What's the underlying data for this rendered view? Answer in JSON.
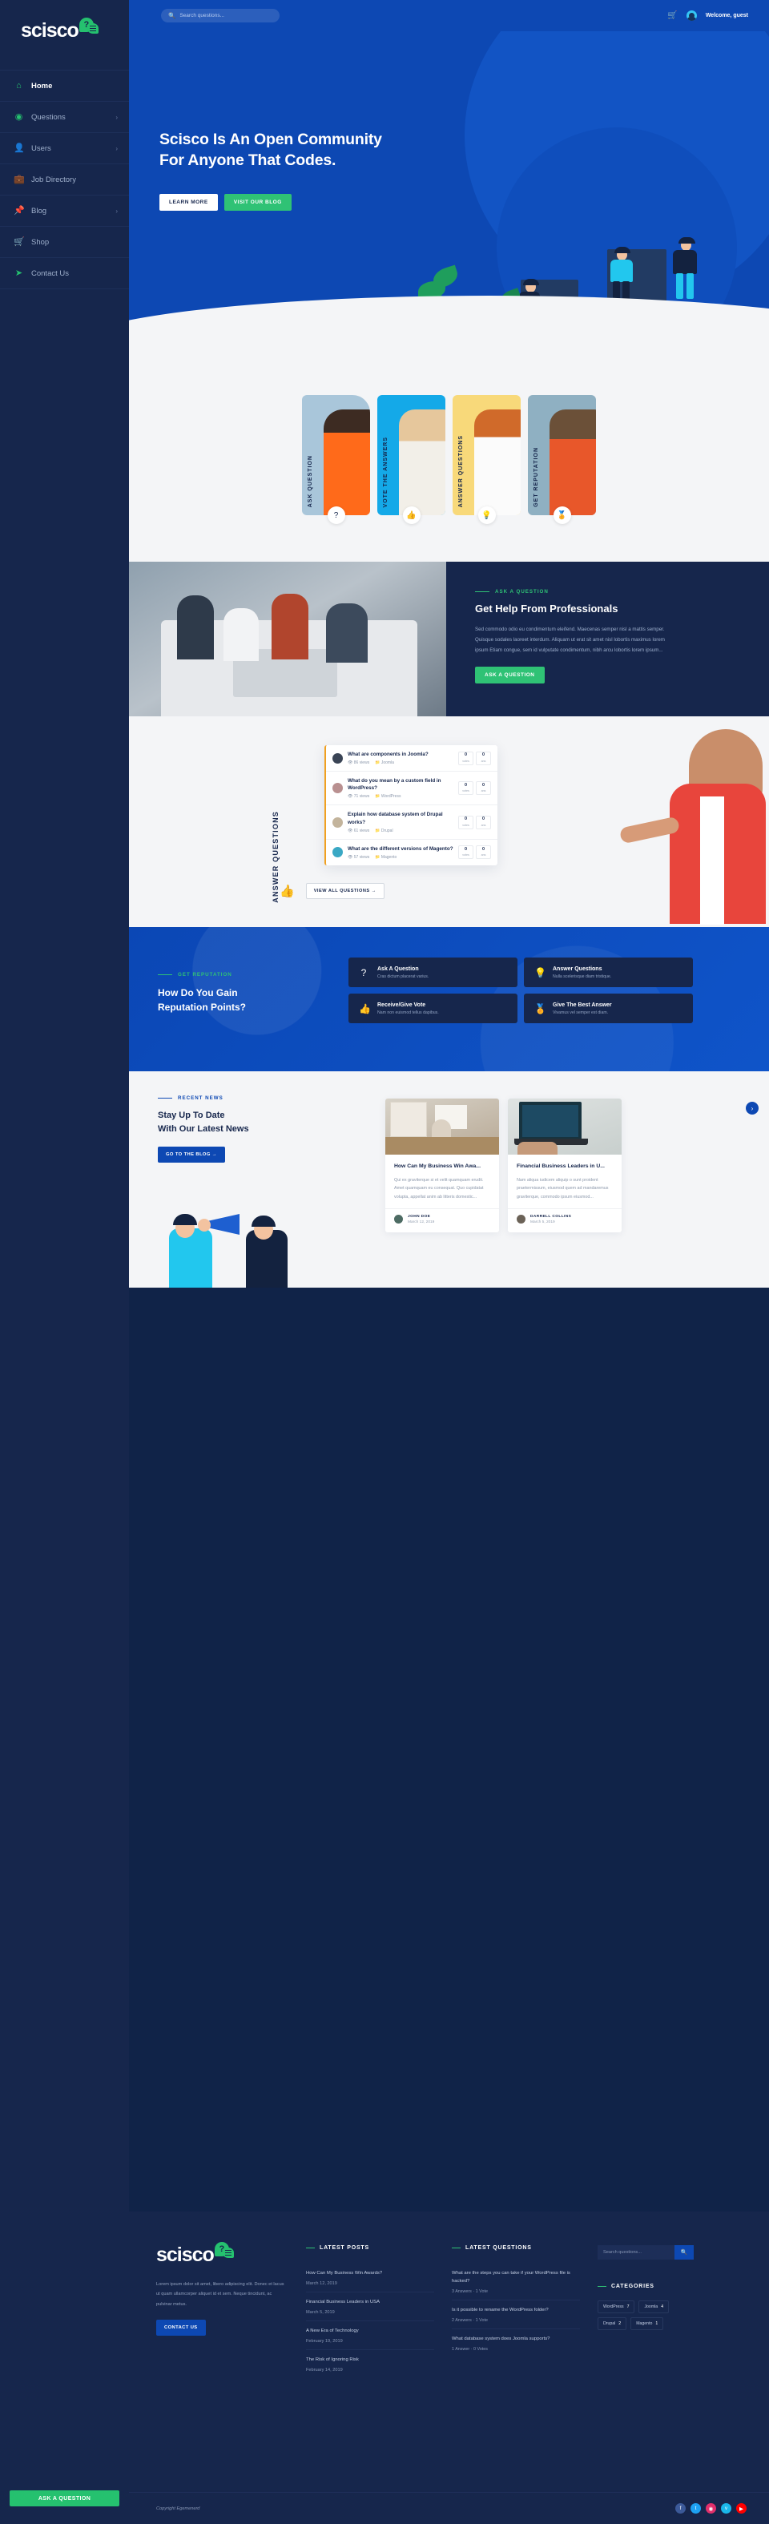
{
  "brand": {
    "name": "scisco",
    "badge_icon": "question-bubble"
  },
  "sidebar": {
    "items": [
      {
        "label": "Home",
        "icon": "home-icon",
        "has_caret": false,
        "active": true
      },
      {
        "label": "Questions",
        "icon": "question-icon",
        "has_caret": true,
        "active": false
      },
      {
        "label": "Users",
        "icon": "user-icon",
        "has_caret": true,
        "active": false
      },
      {
        "label": "Job Directory",
        "icon": "briefcase-icon",
        "has_caret": false,
        "active": false
      },
      {
        "label": "Blog",
        "icon": "pin-icon",
        "has_caret": true,
        "active": false
      },
      {
        "label": "Shop",
        "icon": "cart-icon",
        "has_caret": false,
        "active": false
      },
      {
        "label": "Contact Us",
        "icon": "paper-plane-icon",
        "has_caret": false,
        "active": false
      }
    ],
    "ask_button": "ASK A QUESTION"
  },
  "topbar": {
    "search_placeholder": "Search questions...",
    "cart_icon": "cart-icon",
    "welcome": "Welcome, guest"
  },
  "hero": {
    "title_line1": "Scisco Is An Open Community",
    "title_line2": "For Anyone That Codes.",
    "btn_primary": "LEARN MORE",
    "btn_secondary": "VISIT OUR BLOG"
  },
  "cards": [
    {
      "label": "ASK QUESTION",
      "bg": "#a9c6da",
      "badge": "?",
      "badge_icon": "question-mark-icon"
    },
    {
      "label": "VOTE THE ANSWERS",
      "bg": "#14a9e8",
      "badge": "👍",
      "badge_icon": "thumbs-up-icon"
    },
    {
      "label": "ANSWER QUESTIONS",
      "bg": "#f8d97a",
      "badge": "💡",
      "badge_icon": "lightbulb-icon"
    },
    {
      "label": "GET REPUTATION",
      "bg": "#8fb0c2",
      "badge": "🏅",
      "badge_icon": "medal-icon"
    }
  ],
  "professionals": {
    "eyebrow": "ASK A QUESTION",
    "title": "Get Help From Professionals",
    "body": "Sed commodo odio eu condimentum eleifend. Maecenas semper nisl a mattis semper. Quisque sodales laoreet interdum. Aliquam ut erat sit amet nisl lobortis maximus lorem ipsum Etiam congue, sem id vulputate condimentum, nibh arcu lobortis lorem ipsum...",
    "button": "ASK A QUESTION"
  },
  "answer_questions": {
    "vertical_label": "ANSWER QUESTIONS",
    "view_all": "VIEW ALL QUESTIONS →",
    "thumb_icon": "thumbs-up-icon",
    "stat_labels": {
      "votes": "votes",
      "ans": "ans"
    },
    "rows": [
      {
        "title": "What are components in Joomla?",
        "views": "86 views",
        "category": "Joomla",
        "votes": "0",
        "ans": "0",
        "av": "#3a4455"
      },
      {
        "title": "What do you mean by a custom field in WordPress?",
        "views": "71 views",
        "category": "WordPress",
        "votes": "0",
        "ans": "0",
        "av": "#b99090"
      },
      {
        "title": "Explain how database system of Drupal works?",
        "views": "61 views",
        "category": "Drupal",
        "votes": "0",
        "ans": "0",
        "av": "#c3b49c"
      },
      {
        "title": "What are the different versions of Magento?",
        "views": "57 views",
        "category": "Magento",
        "votes": "0",
        "ans": "0",
        "av": "#3aa8c4"
      }
    ]
  },
  "reputation": {
    "eyebrow": "GET REPUTATION",
    "title_line1": "How Do You Gain",
    "title_line2": "Reputation Points?",
    "cards": [
      {
        "icon": "question-mark-icon",
        "glyph": "?",
        "title": "Ask A Question",
        "desc": "Cras dictum placerat varius."
      },
      {
        "icon": "lightbulb-icon",
        "glyph": "💡",
        "title": "Answer Questions",
        "desc": "Nulla scelerisque diam tristique."
      },
      {
        "icon": "thumbs-up-icon",
        "glyph": "👍",
        "title": "Receive/Give Vote",
        "desc": "Nam non euismod tellus dapibus."
      },
      {
        "icon": "medal-icon",
        "glyph": "🏅",
        "title": "Give The Best Answer",
        "desc": "Vivamus vel semper est diam."
      }
    ]
  },
  "news": {
    "eyebrow": "RECENT NEWS",
    "title_line1": "Stay Up To Date",
    "title_line2": "With Our Latest News",
    "button": "GO TO THE BLOG →",
    "next_icon": "chevron-right-icon",
    "posts": [
      {
        "title": "How Can My Business Win Awa...",
        "excerpt": "Qui ex graviterque si et velit quamquam erudit. Amet quamquam eu consequat. Quo cupidatat volupta, appellat anim ab litteris domestic...",
        "author": "JOHN DOE",
        "date": "March 12, 2019"
      },
      {
        "title": "Financial Business Leaders in U...",
        "excerpt": "Nam aliqua iudicem aliquip o sunt proident praetermissum, eiusmod quem ad mandaremus graviterque, commodo ipsum eiusmod...",
        "author": "DARRELL COLLINS",
        "date": "March 5, 2019"
      }
    ]
  },
  "footer": {
    "about": "Lorem ipsum dolor sit amet, libero adipiscing elit. Donec et lacus ut quam ullamcorper aliquet id et sem. Neque tincidunt, ac pulvinar metus.",
    "contact_button": "CONTACT US",
    "latest_posts_title": "LATEST POSTS",
    "latest_posts": [
      {
        "title": "How Can My Business Win Awards?",
        "date": "March 12, 2019"
      },
      {
        "title": "Financial Business Leaders in USA",
        "date": "March 5, 2019"
      },
      {
        "title": "A New Era of Technology",
        "date": "February 19, 2019"
      },
      {
        "title": "The Risk of Ignoring Risk",
        "date": "February 14, 2019"
      }
    ],
    "latest_questions_title": "LATEST QUESTIONS",
    "latest_questions": [
      {
        "title": "What are the steps you can take if your WordPress file is hacked?",
        "meta": "3 Answers · 1 Vote"
      },
      {
        "title": "Is it possible to rename the WordPress folder?",
        "meta": "2 Answers · 1 Vote"
      },
      {
        "title": "What database system does Joomla supports?",
        "meta": "1 Answer · 0 Votes"
      }
    ],
    "search_placeholder": "Search questions...",
    "search_icon": "search-icon",
    "categories_title": "CATEGORIES",
    "categories": [
      {
        "name": "WordPress",
        "count": "7"
      },
      {
        "name": "Joomla",
        "count": "4"
      },
      {
        "name": "Drupal",
        "count": "2"
      },
      {
        "name": "Magento",
        "count": "1"
      }
    ],
    "copyright": "Copyright Egemenerd",
    "socials": [
      {
        "name": "facebook-icon",
        "glyph": "f",
        "color": "#3b5998"
      },
      {
        "name": "twitter-icon",
        "glyph": "t",
        "color": "#1da1f2"
      },
      {
        "name": "instagram-icon",
        "glyph": "◉",
        "color": "#e1306c"
      },
      {
        "name": "vimeo-icon",
        "glyph": "v",
        "color": "#1ab7ea"
      },
      {
        "name": "youtube-icon",
        "glyph": "▶",
        "color": "#ff0000"
      }
    ]
  },
  "colors": {
    "brand_blue": "#0d48b3",
    "brand_green": "#2fc275",
    "navy": "#16264c",
    "light_bg": "#f4f5f7"
  }
}
